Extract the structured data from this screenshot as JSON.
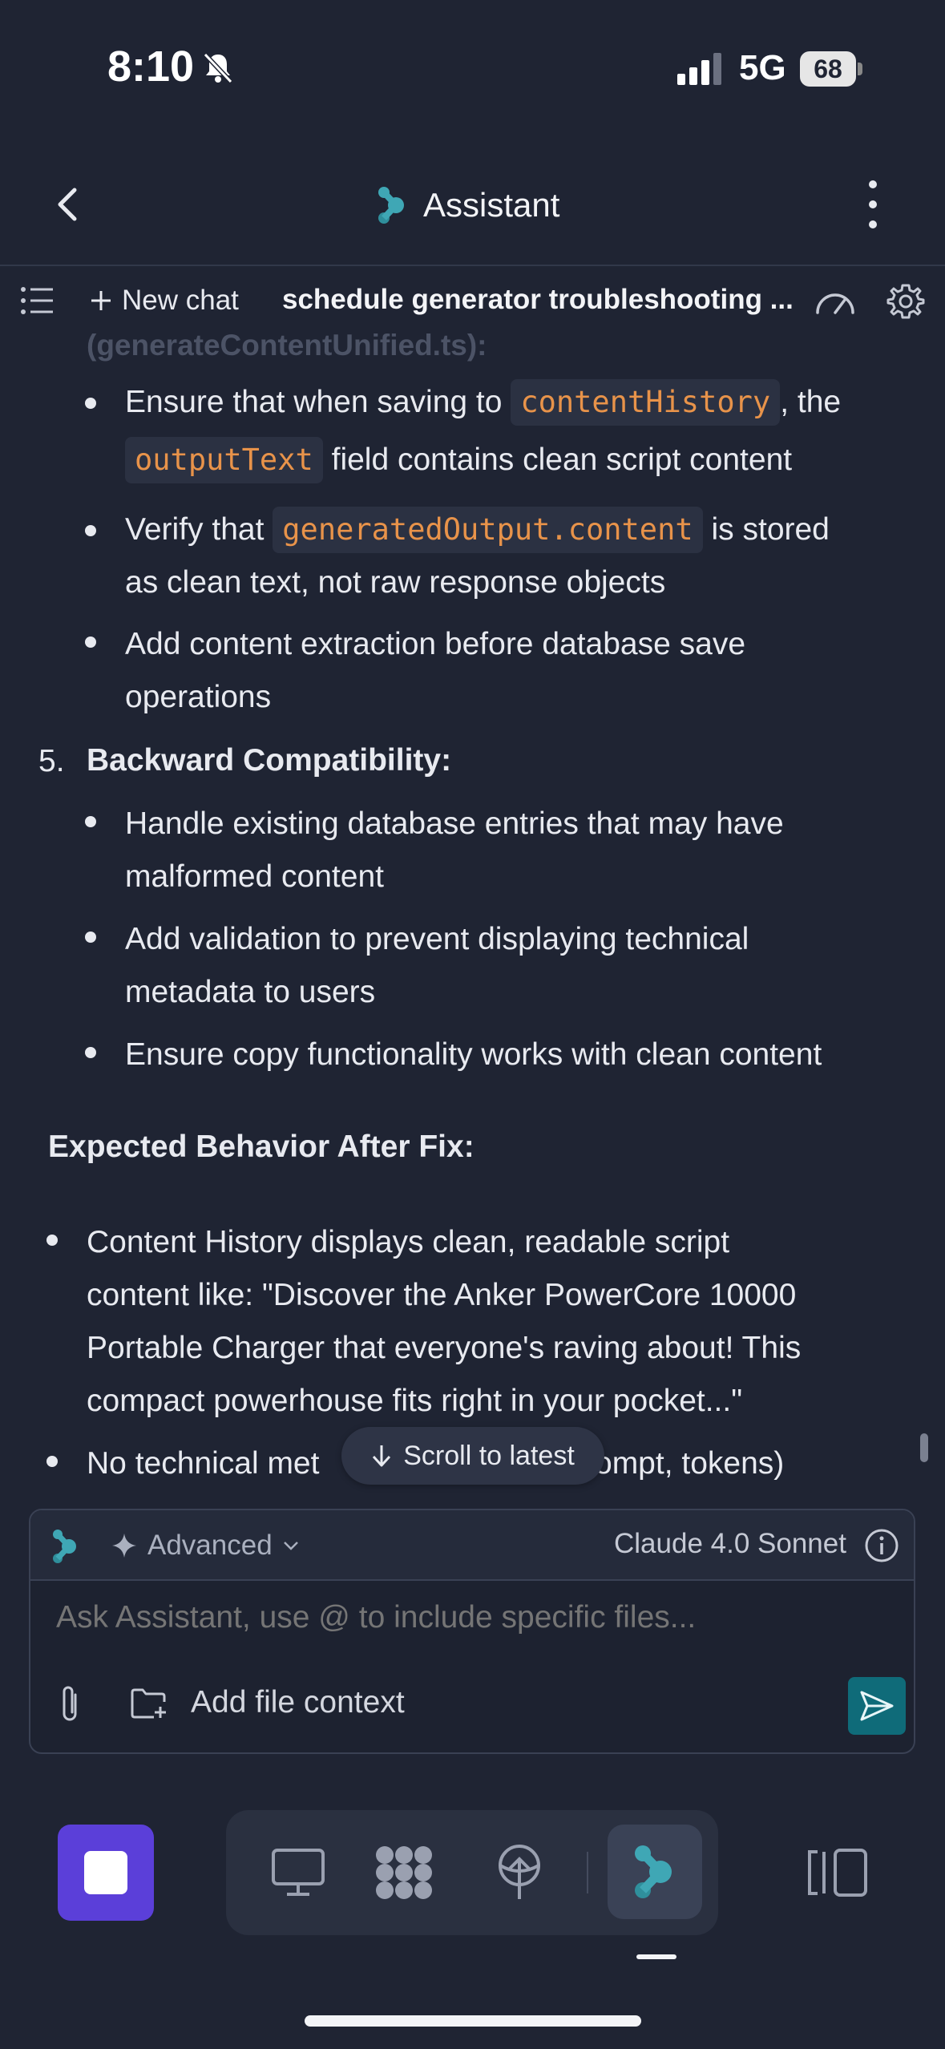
{
  "status_bar": {
    "time": "8:10",
    "network": "5G",
    "battery": "68"
  },
  "header": {
    "title": "Assistant"
  },
  "toolbar": {
    "new_chat_label": "New chat",
    "chat_title": "schedule generator troubleshooting ..."
  },
  "message": {
    "faded_heading": "(generateContentUnified.ts):",
    "section4_bullets": [
      {
        "line1_pre": "Ensure that when saving to",
        "line1_code": "contentHistory",
        "line1_post": ", the",
        "line2_code": "outputText",
        "line2_post": "field contains clean script content"
      },
      {
        "line1_pre": "Verify that",
        "line1_code": "generatedOutput.content",
        "line1_post": "is stored",
        "line2": "as clean text, not raw response objects"
      },
      {
        "line1": "Add content extraction before database save",
        "line2": "operations"
      }
    ],
    "section5": {
      "number": "5.",
      "heading": "Backward Compatibility:",
      "bullets": [
        {
          "line1": "Handle existing database entries that may have",
          "line2": "malformed content"
        },
        {
          "line1": "Add validation to prevent displaying technical",
          "line2": "metadata to users"
        },
        {
          "line1": "Ensure copy functionality works with clean content"
        }
      ]
    },
    "expected_heading": "Expected Behavior After Fix:",
    "expected_bullets": [
      {
        "lines": [
          "Content History displays clean, readable script",
          "content like: \"Discover the Anker PowerCore 10000",
          "Portable Charger that everyone's raving about! This",
          "compact powerhouse fits right in your pocket...\""
        ]
      },
      {
        "line1_left": "No technical met",
        "line1_right": "ompt, tokens)"
      }
    ]
  },
  "scroll_latest_label": "Scroll to latest",
  "composer": {
    "mode_label": "Advanced",
    "model_name": "Claude 4.0 Sonnet",
    "placeholder": "Ask Assistant, use @ to include specific files...",
    "add_file_context_label": "Add file context"
  },
  "colors": {
    "background": "#1f2433",
    "code_text": "#e8934a",
    "accent_teal": "#0f6b79",
    "stop_purple": "#5b3fd9"
  },
  "icons": [
    "bell-muted-icon",
    "signal-icon",
    "chevron-left-icon",
    "assistant-logo-icon",
    "more-vertical-icon",
    "list-icon",
    "plus-icon",
    "speedometer-icon",
    "gear-icon",
    "arrow-down-icon",
    "sparkle-icon",
    "chevron-down-icon",
    "info-icon",
    "paperclip-icon",
    "folder-plus-icon",
    "send-icon",
    "stop-icon",
    "monitor-icon",
    "apps-grid-icon",
    "deploy-icon",
    "panel-toggle-icon"
  ]
}
